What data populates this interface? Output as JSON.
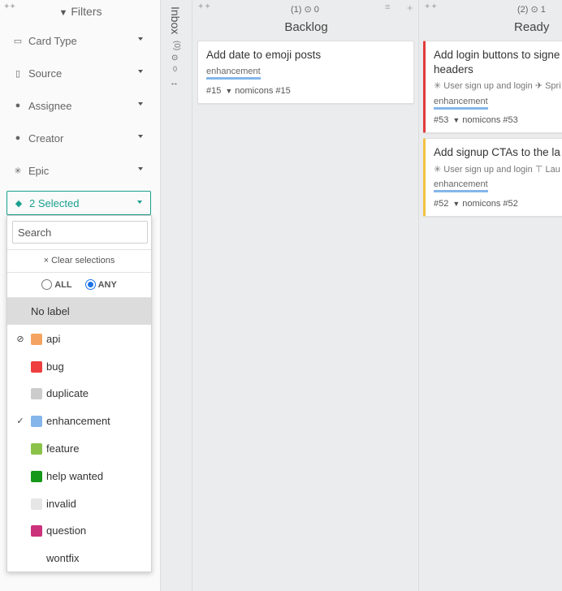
{
  "sidebar": {
    "title": "Filters",
    "filters": [
      {
        "label": "Card Type",
        "icon": "card-icon"
      },
      {
        "label": "Source",
        "icon": "source-icon"
      },
      {
        "label": "Assignee",
        "icon": "person-icon"
      },
      {
        "label": "Creator",
        "icon": "person-add-icon"
      },
      {
        "label": "Epic",
        "icon": "epic-icon"
      }
    ],
    "label_filter": {
      "value": "2 Selected",
      "icon": "tag-icon"
    }
  },
  "dropdown": {
    "search_placeholder": "Search",
    "clear_label": "Clear selections",
    "radio_all": "ALL",
    "radio_any": "ANY",
    "selected_mode": "ANY",
    "items": [
      {
        "label": "No label",
        "color": "",
        "mark": "",
        "highlighted": true
      },
      {
        "label": "api",
        "color": "#f4a460",
        "mark": "excluded"
      },
      {
        "label": "bug",
        "color": "#ee3e3e",
        "mark": ""
      },
      {
        "label": "duplicate",
        "color": "#cccccc",
        "mark": ""
      },
      {
        "label": "enhancement",
        "color": "#84b6eb",
        "mark": "checked"
      },
      {
        "label": "feature",
        "color": "#8bc34a",
        "mark": ""
      },
      {
        "label": "help wanted",
        "color": "#159818",
        "mark": ""
      },
      {
        "label": "invalid",
        "color": "#e6e6e6",
        "mark": ""
      },
      {
        "label": "question",
        "color": "#cc317c",
        "mark": ""
      },
      {
        "label": "wontfix",
        "color": "",
        "mark": ""
      }
    ]
  },
  "inbox": {
    "title": "Inbox",
    "count": "(0)",
    "zero": "0"
  },
  "columns": {
    "backlog": {
      "title": "Backlog",
      "count": "(1)",
      "points": "0",
      "cards": [
        {
          "title": "Add date to emoji posts",
          "label": "enhancement",
          "number": "#15",
          "repo": "nomicons #15"
        }
      ]
    },
    "ready": {
      "title": "Ready",
      "count": "(2)",
      "points": "1",
      "cards": [
        {
          "title_line1": "Add login buttons to signe",
          "title_line2": "headers",
          "epic": "User sign up and login",
          "extra": "Spri",
          "label": "enhancement",
          "number": "#53",
          "repo": "nomicons #53",
          "accent": "#e23a3a"
        },
        {
          "title_line1": "Add signup CTAs to the la",
          "epic": "User sign up and login",
          "extra": "Lau",
          "label": "enhancement",
          "number": "#52",
          "repo": "nomicons #52",
          "accent": "#f2c240"
        }
      ]
    }
  }
}
